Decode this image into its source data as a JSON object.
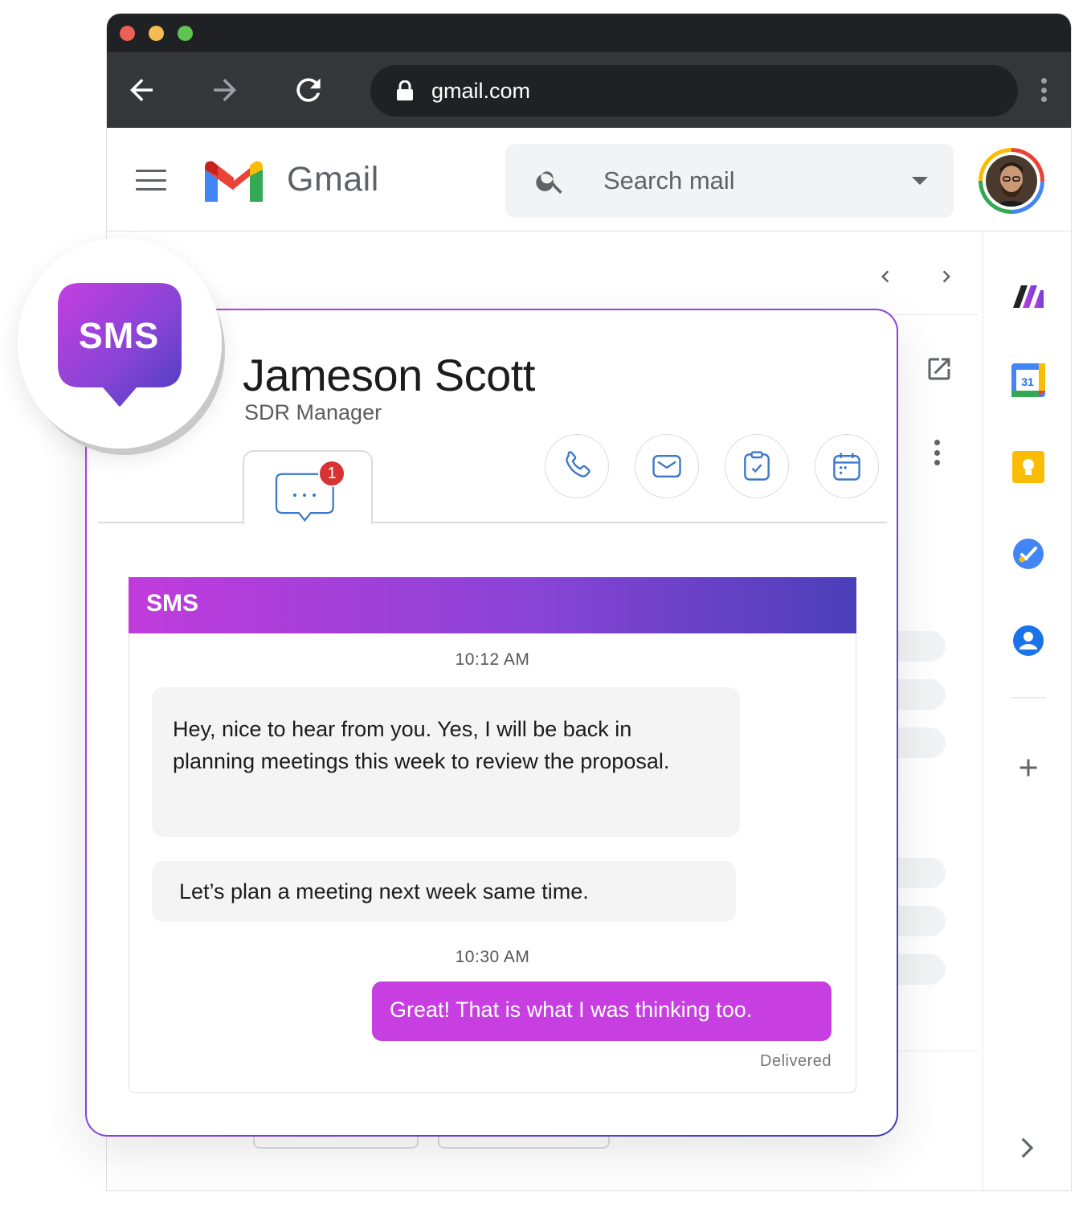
{
  "browser": {
    "url": "gmail.com",
    "traffic_lights": [
      "#ee5f57",
      "#f5bd4f",
      "#5fc454"
    ]
  },
  "gmail": {
    "brand": "Gmail",
    "search_placeholder": "Search mail"
  },
  "badge_logo": {
    "text": "SMS"
  },
  "contact": {
    "name": "Jameson Scott",
    "role": "SDR Manager",
    "unread_count": "1",
    "actions": [
      "phone-icon",
      "email-icon",
      "task-clipboard-icon",
      "calendar-icon"
    ]
  },
  "sms": {
    "header": "SMS",
    "messages": [
      {
        "time": "10:12 AM"
      },
      {
        "direction": "incoming",
        "text_line1": "Hey, nice to hear from you. Yes, I will be back in",
        "text_line2": "planning meetings this week to review the proposal."
      },
      {
        "direction": "incoming",
        "text": "Let’s plan a meeting next week same time."
      },
      {
        "time": "10:30 AM"
      },
      {
        "direction": "outgoing",
        "text": "Great! That is what I was thinking too."
      }
    ],
    "status": "Delivered"
  },
  "side_panel": {
    "apps": [
      "app-logo-icon",
      "google-calendar-icon",
      "google-keep-icon",
      "google-tasks-icon",
      "google-contacts-icon"
    ],
    "calendar_day": "31"
  },
  "colors": {
    "accent_purple": "#c73fe0",
    "gradient_end": "#3d3fb8",
    "badge_red": "#d93232",
    "icon_blue": "#3a78c9"
  }
}
